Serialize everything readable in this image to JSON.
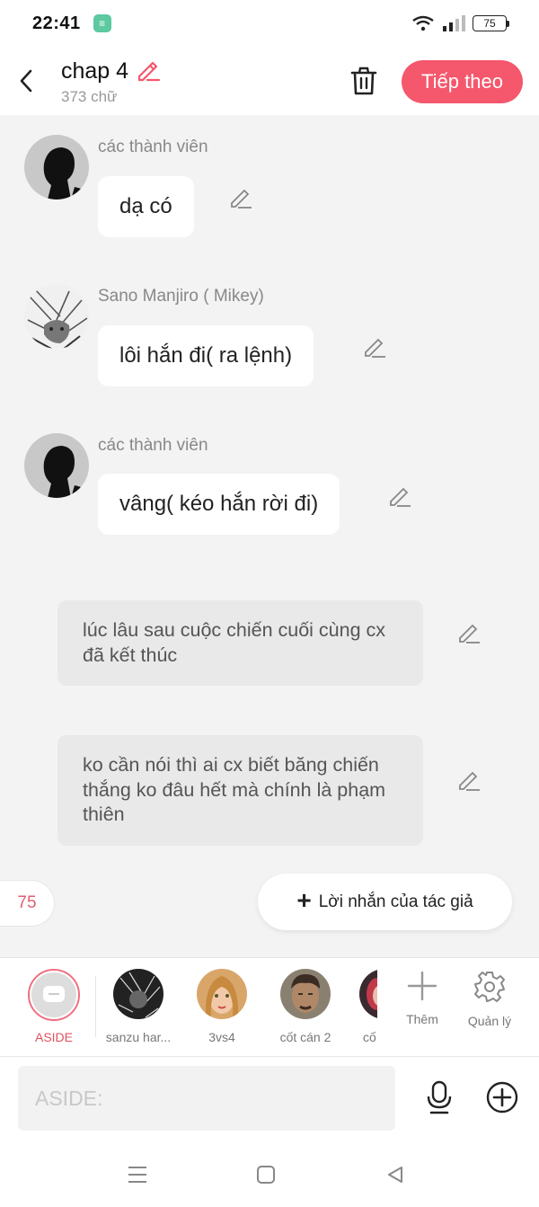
{
  "status_bar": {
    "time": "22:41",
    "battery": "75"
  },
  "header": {
    "title": "chap 4",
    "word_count": "373 chữ",
    "next_label": "Tiếp theo"
  },
  "messages": [
    {
      "sender": "các thành viên",
      "text": "dạ có"
    },
    {
      "sender": "Sano Manjiro ( Mikey)",
      "text": "lôi hắn đi( ra lệnh)"
    },
    {
      "sender": "các thành viên",
      "text": "vâng( kéo hắn rời đi)"
    }
  ],
  "narrations": [
    {
      "text": "lúc lâu sau cuộc chiến cuối cùng cx đã kết thúc"
    },
    {
      "text": "ko cần nói thì ai cx biết băng chiến thắng ko đâu hết mà chính là phạm thiên"
    }
  ],
  "counter": "75",
  "author_note_label": "Lời nhắn của tác giả",
  "characters": [
    {
      "name": "ASIDE"
    },
    {
      "name": "sanzu har..."
    },
    {
      "name": "3vs4"
    },
    {
      "name": "cốt cán 2"
    },
    {
      "name": "cố"
    }
  ],
  "tools": {
    "add_label": "Thêm",
    "manage_label": "Quản lý"
  },
  "input": {
    "placeholder": "ASIDE:"
  },
  "colors": {
    "accent": "#f5576c",
    "counter": "#e06070"
  }
}
